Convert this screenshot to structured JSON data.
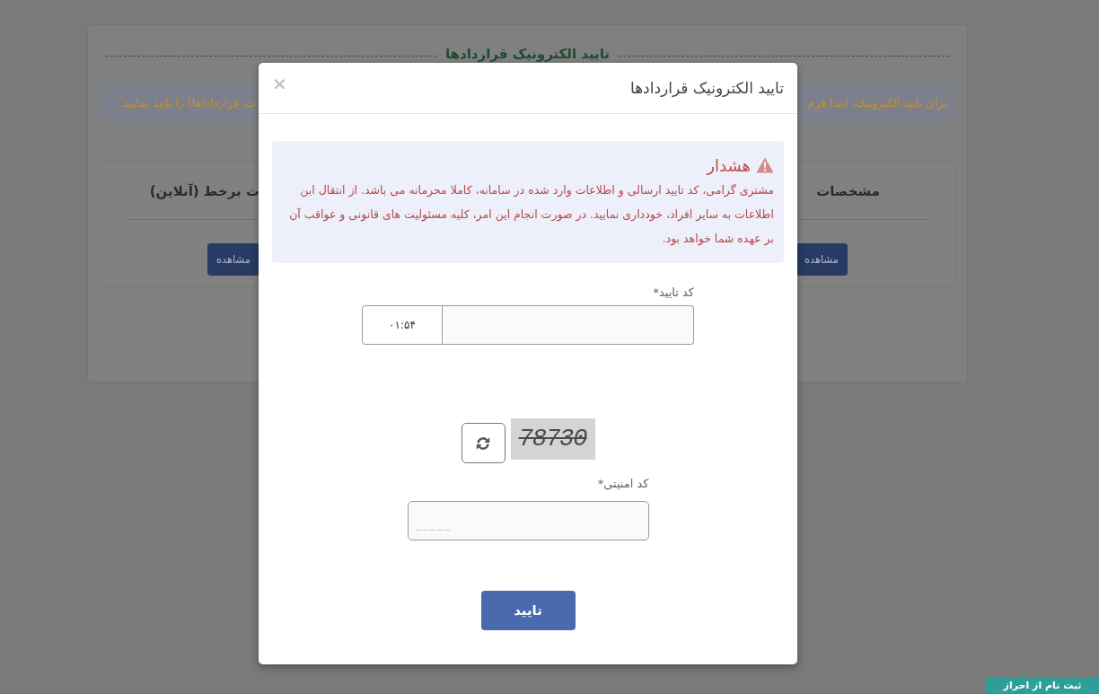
{
  "page": {
    "title": "تایید الکترونیک قراردادها",
    "notice_parts": [
      "برای تایید الکترونیک، ابتدا فرم",
      "ت، قرارداد(ها) را تایید نمایید."
    ],
    "cards": [
      {
        "title": "مشخصات",
        "button": "مشاهده"
      },
      {
        "title": "ت برخط (آنلاین)",
        "button": "مشاهده"
      }
    ]
  },
  "modal": {
    "title": "تایید الکترونیک قراردادها",
    "close": "×",
    "alert": {
      "heading": "هشدار",
      "text": "مشتری گرامی، کد تایید ارسالی و اطلاعات وارد شده در سامانه، کاملا محرمانه می باشد. از انتقال این اطلاعات به سایر افراد، خودداری نمایید. در صورت انجام این امر، کلیه مسئولیت های قانونی و عواقب آن بر عهده شما خواهد بود."
    },
    "verification_code": {
      "label": "کد تایید*",
      "timer": "۰۱:۵۴"
    },
    "captcha": {
      "code": "78730",
      "label": "کد امنیتی*",
      "placeholder": "_____"
    },
    "submit": "تایید"
  },
  "corner_button": "ثبت نام از احراز"
}
